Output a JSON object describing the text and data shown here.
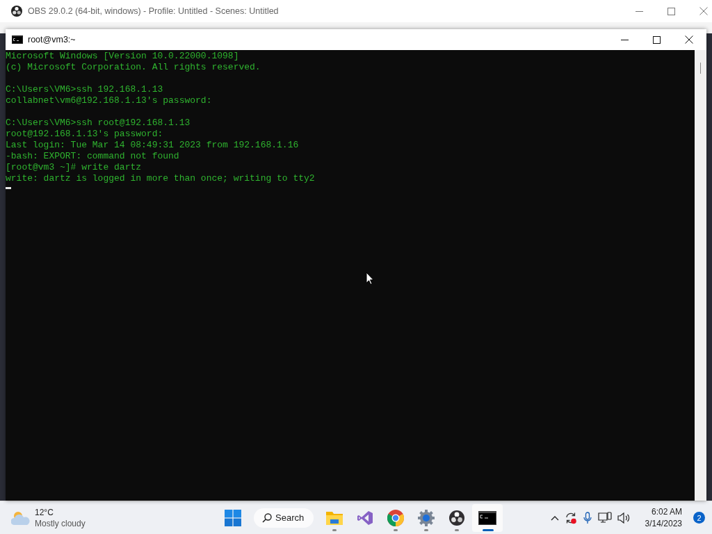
{
  "obs_window": {
    "title": "OBS 29.0.2 (64-bit, windows) - Profile: Untitled - Scenes: Untitled"
  },
  "terminal_window": {
    "title": "root@vm3:~",
    "blocks": [
      [
        "Microsoft Windows [Version 10.0.22000.1098]",
        "(c) Microsoft Corporation. All rights reserved."
      ],
      [
        "C:\\Users\\VM6>ssh 192.168.1.13",
        "collabnet\\vm6@192.168.1.13's password:"
      ],
      [
        "C:\\Users\\VM6>ssh root@192.168.1.13",
        "root@192.168.1.13's password:",
        "Last login: Tue Mar 14 08:49:31 2023 from 192.168.1.16",
        "-bash: EXPORT: command not found",
        "[root@vm3 ~]# write dartz",
        "write: dartz is logged in more than once; writing to tty2"
      ]
    ],
    "cursor": true
  },
  "taskbar": {
    "weather": {
      "temperature": "12°C",
      "condition": "Mostly cloudy"
    },
    "search": {
      "label": "Search"
    },
    "apps": [
      {
        "kind": "files",
        "running": true,
        "selected": false
      },
      {
        "kind": "visual-studio",
        "running": false,
        "selected": false
      },
      {
        "kind": "chrome",
        "running": true,
        "selected": false
      },
      {
        "kind": "settings",
        "running": true,
        "selected": false
      },
      {
        "kind": "obs",
        "running": true,
        "selected": false
      },
      {
        "kind": "terminal",
        "running": true,
        "selected": true
      }
    ],
    "clock": {
      "time": "6:02 AM",
      "date": "3/14/2023"
    },
    "notification_count": "2"
  }
}
